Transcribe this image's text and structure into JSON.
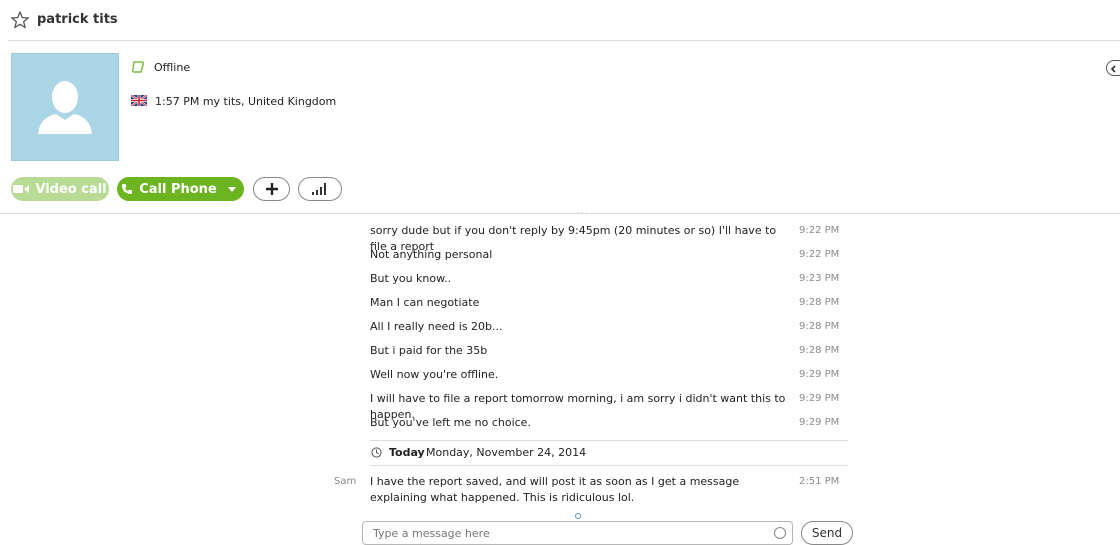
{
  "header": {
    "title": "patrick tits"
  },
  "profile": {
    "status": "Offline",
    "location": "1:57 PM my tits, United Kingdom",
    "status_color": "#7ac143"
  },
  "actions": {
    "video_call": "Video call",
    "call_phone": "Call Phone",
    "accent": "#6cb420"
  },
  "chat": {
    "divider": "...",
    "messages": [
      {
        "text": "sorry dude but if you don't reply by 9:45pm (20 minutes or so) I'll have to file a report",
        "time": "9:22 PM"
      },
      {
        "text": "Not anything personal",
        "time": "9:22 PM"
      },
      {
        "text": "But you know..",
        "time": "9:23 PM"
      },
      {
        "text": "Man I can negotiate",
        "time": "9:28 PM"
      },
      {
        "text": "All I really need is 20b...",
        "time": "9:28 PM"
      },
      {
        "text": "But i paid for the 35b",
        "time": "9:28 PM"
      },
      {
        "text": "Well now you're offline.",
        "time": "9:29 PM"
      },
      {
        "text": "I will have to file a report tomorrow morning, i am sorry i didn't want this to happen.",
        "time": "9:29 PM"
      },
      {
        "text": "But you've left me no choice.",
        "time": "9:29 PM"
      }
    ],
    "today": {
      "label": "Today",
      "date": "Monday, November 24, 2014"
    },
    "latest": {
      "sender": "Sam",
      "text": "I have the report saved, and will post it as soon as I get a message explaining what happened. This is ridiculous lol.",
      "time": "2:51 PM"
    }
  },
  "composer": {
    "placeholder": "Type a message here",
    "send_label": "Send"
  }
}
